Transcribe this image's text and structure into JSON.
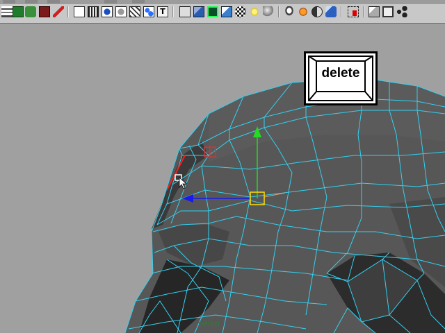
{
  "app": {
    "viewport_camera": "persp"
  },
  "toolbar": {
    "icons": [
      "list-icon",
      "channel-box-icon",
      "snap-icon",
      "tool-icon",
      "paint-icon",
      "layer-icon",
      "film-icon",
      "render-icon",
      "hypershade-icon",
      "grid-icon",
      "text-tool-icon",
      "cube-wireframe-icon",
      "cube-shaded-icon",
      "wireframe-on-shaded-icon",
      "cube-textured-icon",
      "checker-texture-icon",
      "light-icon",
      "sphere-icon",
      "lamp-icon",
      "camera-icon",
      "half-sphere-icon",
      "cube-blue-icon",
      "marquee-select-icon",
      "isolate-icon",
      "frame-icon",
      "share-icon"
    ],
    "text_tool_label": "T"
  },
  "overlay": {
    "key_label": "delete"
  },
  "colors": {
    "viewport_bg": "#a0a0a0",
    "mesh_face": "#555555",
    "wire": "#33d1f0",
    "selected_edge": "#ff1a1a",
    "axis_y": "#22dd22",
    "axis_x": "#1a1aee",
    "manipulator": "#ffdd00"
  }
}
